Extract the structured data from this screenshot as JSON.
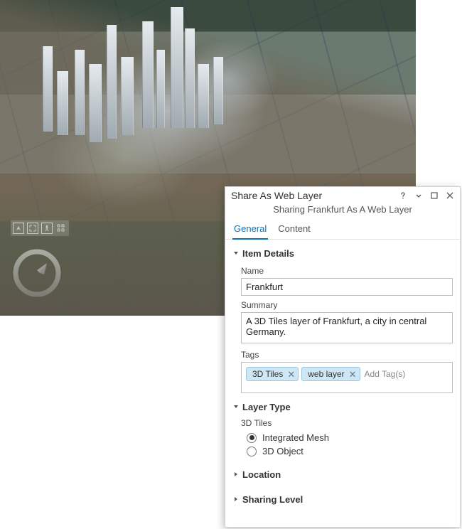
{
  "panel": {
    "title": "Share As Web Layer",
    "subtitle": "Sharing Frankfurt As A Web Layer",
    "tabs": {
      "general": "General",
      "content": "Content"
    },
    "sections": {
      "item_details": {
        "title": "Item Details",
        "name_label": "Name",
        "name_value": "Frankfurt",
        "summary_label": "Summary",
        "summary_value": "A 3D Tiles layer of Frankfurt, a city in central Germany.",
        "tags_label": "Tags",
        "tags": [
          "3D Tiles",
          "web layer"
        ],
        "add_tag_placeholder": "Add Tag(s)"
      },
      "layer_type": {
        "title": "Layer Type",
        "sublabel": "3D Tiles",
        "options": {
          "integrated_mesh": "Integrated Mesh",
          "object_3d": "3D Object"
        },
        "selected": "integrated_mesh"
      },
      "location": {
        "title": "Location"
      },
      "sharing_level": {
        "title": "Sharing Level"
      }
    }
  }
}
